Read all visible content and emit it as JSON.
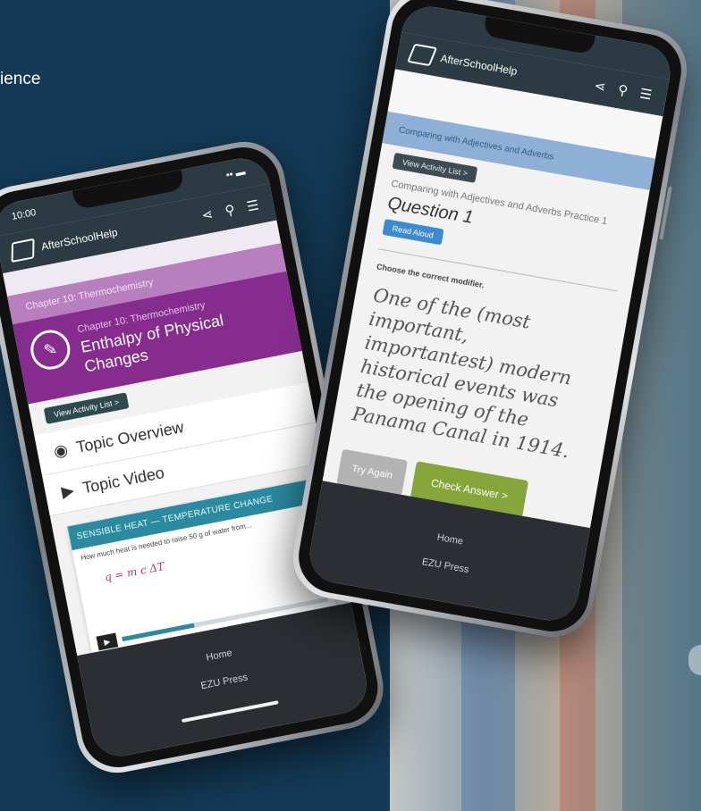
{
  "background": {
    "partial_text": "ience",
    "colors": {
      "left": "#143a56",
      "purple": "#862c8e",
      "green": "#86a53a",
      "blue_band": "#8fb0d6"
    }
  },
  "phone_left": {
    "status": {
      "time": "10:00",
      "battery": "▪▪ ▬"
    },
    "app_name": "AfterSchoolHelp",
    "icons": [
      "share-icon",
      "search-icon",
      "menu-icon"
    ],
    "chapter_label": "Chapter 10: Thermochemistry",
    "topic": {
      "chapter": "Chapter 10: Thermochemistry",
      "title": "Enthalpy of Physical Changes"
    },
    "activity_button": "View Activity List >",
    "sections": [
      {
        "icon": "eye-icon",
        "label": "Topic Overview"
      },
      {
        "icon": "play-triangle-icon",
        "label": "Topic Video"
      }
    ],
    "video": {
      "title": "SENSIBLE HEAT — TEMPERATURE CHANGE",
      "body_text": "How much heat is needed to raise 50 g of water from...",
      "scribble": "q = m c ΔT",
      "progress_fraction": 0.35
    },
    "tabbar": {
      "item1": "Home",
      "item2": "EZU Press"
    }
  },
  "phone_right": {
    "app_name": "AfterSchoolHelp",
    "icons": [
      "share-icon",
      "search-icon",
      "menu-icon"
    ],
    "blue_band_text": "Comparing with Adjectives and Adverbs",
    "tag": "View Activity List >",
    "lesson": "Comparing with Adjectives and Adverbs Practice 1",
    "question": "Question 1",
    "small_button": "Read Aloud",
    "instruction": "Choose the correct modifier.",
    "sentence": "One of the (most important, importantest) modern historical events was the opening of the Panama Canal in 1914.",
    "btn_skip": "Try Again",
    "btn_check": "Check Answer >",
    "tabbar": {
      "item1": "Home",
      "item2": "EZU Press"
    }
  }
}
